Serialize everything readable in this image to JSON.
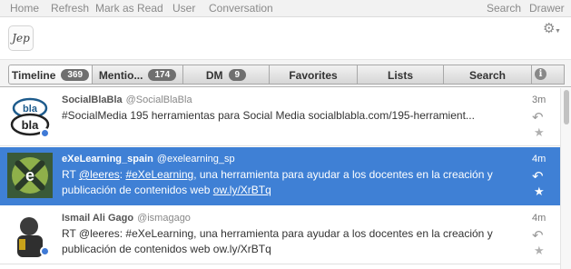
{
  "menu": {
    "home": "Home",
    "refresh": "Refresh",
    "mark_as_read": "Mark as Read",
    "user": "User",
    "conversation": "Conversation",
    "search": "Search",
    "drawer": "Drawer"
  },
  "account": {
    "logo_text": "Jep"
  },
  "tabs": [
    {
      "label": "Timeline",
      "badge": "369"
    },
    {
      "label": "Mentio...",
      "badge": "174"
    },
    {
      "label": "DM",
      "badge": "9"
    },
    {
      "label": "Favorites"
    },
    {
      "label": "Lists"
    },
    {
      "label": "Search"
    }
  ],
  "tweets": [
    {
      "name": "SocialBlaBla",
      "handle": "@SocialBlaBla",
      "time": "3m",
      "text": "#SocialMedia 195 herramientas para Social Media socialblabla.com/195-herramient..."
    },
    {
      "name": "eXeLearning_spain",
      "handle": "@exelearning_sp",
      "time": "4m",
      "text_parts": [
        "RT ",
        "@leeres",
        ": ",
        "#eXeLearning",
        ", una herramienta  para ayudar a los docentes en la creación y publicación de contenidos web ",
        "ow.ly/XrBTq"
      ]
    },
    {
      "name": "Ismail Ali Gago",
      "handle": "@ismagago",
      "time": "4m",
      "text": "RT @leeres: #eXeLearning, una herramienta  para ayudar a los docentes en la creación y publicación de contenidos web ow.ly/XrBTq"
    }
  ],
  "colors": {
    "selection": "#3f80d5",
    "badge": "#6f6f6f",
    "presence": "#3f7ad6"
  },
  "icons": {
    "settings": "gear-icon",
    "info": "info-icon",
    "reply": "reply-icon",
    "favorite": "star-icon"
  }
}
